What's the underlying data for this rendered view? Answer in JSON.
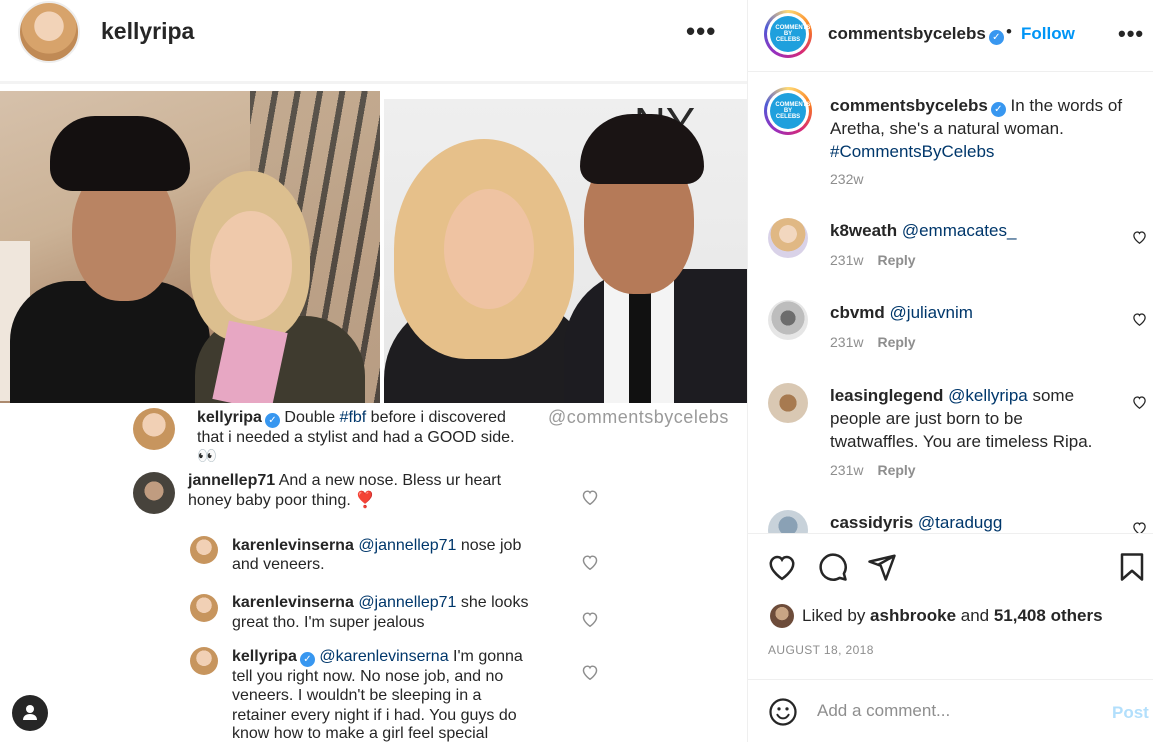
{
  "screenshot": {
    "username": "kellyripa",
    "watermark": "@commentsbycelebs",
    "caption": {
      "user": "kellyripa",
      "text_before": "Double ",
      "hashtag": "#fbf",
      "text_after": " before i discovered",
      "line2": "that i needed a stylist and had a GOOD side.",
      "line3": "👀"
    },
    "comments": [
      {
        "user": "jannellep71",
        "line1": "And a new nose. Bless ur heart",
        "line2": "honey baby poor thing. ❣️"
      },
      {
        "user": "karenlevinserna",
        "mention": "@jannellep71",
        "line1": " nose job",
        "line2": "and veneers."
      },
      {
        "user": "karenlevinserna",
        "mention": "@jannellep71",
        "line1": " she looks",
        "line2": "great tho. I'm super jealous"
      },
      {
        "user": "kellyripa",
        "mention": "@karenlevinserna",
        "line1": " I'm gonna",
        "lines": [
          "tell you right now. No nose job, and no",
          "veneers. I wouldn't be sleeping in a",
          "retainer every night if i had. You guys do",
          "know how to make a girl feel special"
        ]
      }
    ]
  },
  "panel": {
    "header": {
      "username": "commentsbycelebs",
      "dot": "•",
      "follow": "Follow",
      "more": "•••",
      "brand": "COMMENTS BY CELEBS"
    },
    "caption": {
      "user": "commentsbycelebs",
      "text": "In the words of",
      "line2": "Aretha, she's a natural woman.",
      "hashtag": "#CommentsByCelebs",
      "time": "232w"
    },
    "comments": [
      {
        "user": "k8weath",
        "mention": "@emmacates_",
        "time": "231w",
        "reply": "Reply"
      },
      {
        "user": "cbvmd",
        "mention": "@juliavnim",
        "time": "231w",
        "reply": "Reply"
      },
      {
        "user": "leasinglegend",
        "mention": "@kellyripa",
        "text": " some",
        "line2": "people are just born to be",
        "line3": "twatwaffles. You are timeless Ripa.",
        "time": "231w",
        "reply": "Reply"
      },
      {
        "user": "cassidyris",
        "mention": "@taradugg"
      }
    ],
    "likes": {
      "prefix": "Liked by ",
      "user": "ashbrooke",
      "middle": " and ",
      "count": "51,408 others"
    },
    "date": "AUGUST 18, 2018",
    "add_comment_placeholder": "Add a comment...",
    "post": "Post"
  }
}
